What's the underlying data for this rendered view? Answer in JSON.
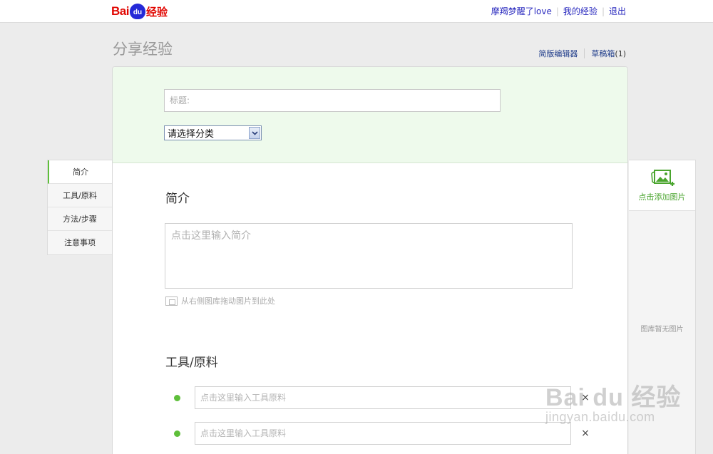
{
  "header": {
    "logo": {
      "text_left": "Bai",
      "text_paw": "du",
      "text_right": "经验"
    },
    "links": {
      "user": "摩羯梦醒了love",
      "my_exp": "我的经验",
      "logout": "退出"
    }
  },
  "page": {
    "title": "分享经验",
    "simple_editor": "简版编辑器",
    "drafts_label": "草稿箱",
    "drafts_count": "(1)"
  },
  "form": {
    "title_placeholder": "标题:",
    "category_value": "请选择分类",
    "intro_heading": "简介",
    "intro_placeholder": "点击这里输入简介",
    "drag_hint": "从右侧图库拖动图片到此处",
    "tools_heading": "工具/原料",
    "tool_rows": [
      {
        "placeholder": "点击这里输入工具原料",
        "delete": "×"
      },
      {
        "placeholder": "点击这里输入工具原料",
        "delete": "×"
      }
    ]
  },
  "left_nav": {
    "items": [
      {
        "label": "简介"
      },
      {
        "label": "工具/原料"
      },
      {
        "label": "方法/步骤"
      },
      {
        "label": "注意事项"
      }
    ]
  },
  "right_panel": {
    "add_label": "点击添加图片",
    "empty_text": "图库暂无图片"
  },
  "watermark": {
    "logo": "Bai du 经验",
    "url": "jingyan.baidu.com"
  },
  "colors": {
    "accent_green": "#5ebf3a",
    "link_blue": "#1f3c8a",
    "brand_red": "#e10601"
  }
}
